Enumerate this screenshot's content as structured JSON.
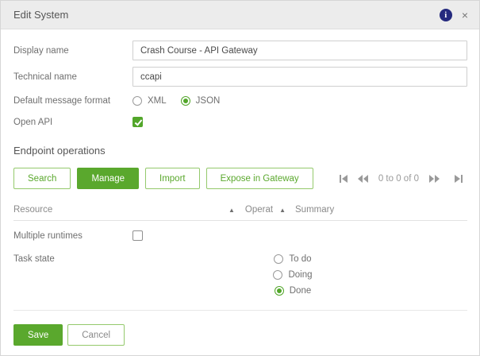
{
  "dialog": {
    "title": "Edit System",
    "info_icon_glyph": "i",
    "close_icon_glyph": "×"
  },
  "form": {
    "display_name": {
      "label": "Display name",
      "value": "Crash Course - API Gateway"
    },
    "technical_name": {
      "label": "Technical name",
      "value": "ccapi"
    },
    "default_message_format": {
      "label": "Default message format",
      "options": [
        {
          "label": "XML",
          "selected": false
        },
        {
          "label": "JSON",
          "selected": true
        }
      ]
    },
    "open_api": {
      "label": "Open API",
      "checked": true
    },
    "multiple_runtimes": {
      "label": "Multiple runtimes",
      "checked": false
    },
    "task_state": {
      "label": "Task state",
      "options": [
        {
          "label": "To do",
          "selected": false
        },
        {
          "label": "Doing",
          "selected": false
        },
        {
          "label": "Done",
          "selected": true
        }
      ]
    }
  },
  "endpoint_operations": {
    "section_title": "Endpoint operations",
    "buttons": [
      {
        "label": "Search",
        "variant": "outline"
      },
      {
        "label": "Manage",
        "variant": "filled"
      },
      {
        "label": "Import",
        "variant": "outline"
      },
      {
        "label": "Expose in Gateway",
        "variant": "outline"
      }
    ],
    "pagination": {
      "text": "0 to 0 of 0",
      "icons": [
        "first-page",
        "previous-page",
        "next-page",
        "last-page"
      ]
    },
    "table": {
      "columns": [
        "Resource",
        "Operat",
        "Summary"
      ],
      "sort_arrow_glyph": "▲",
      "rows": []
    }
  },
  "footer": {
    "save_label": "Save",
    "cancel_label": "Cancel"
  },
  "colors": {
    "accent_green": "#5aa82d",
    "control_green": "#52a62a",
    "outline_green_border": "#94c96c",
    "header_background": "#ececec",
    "info_icon_navy": "#252a7e"
  }
}
